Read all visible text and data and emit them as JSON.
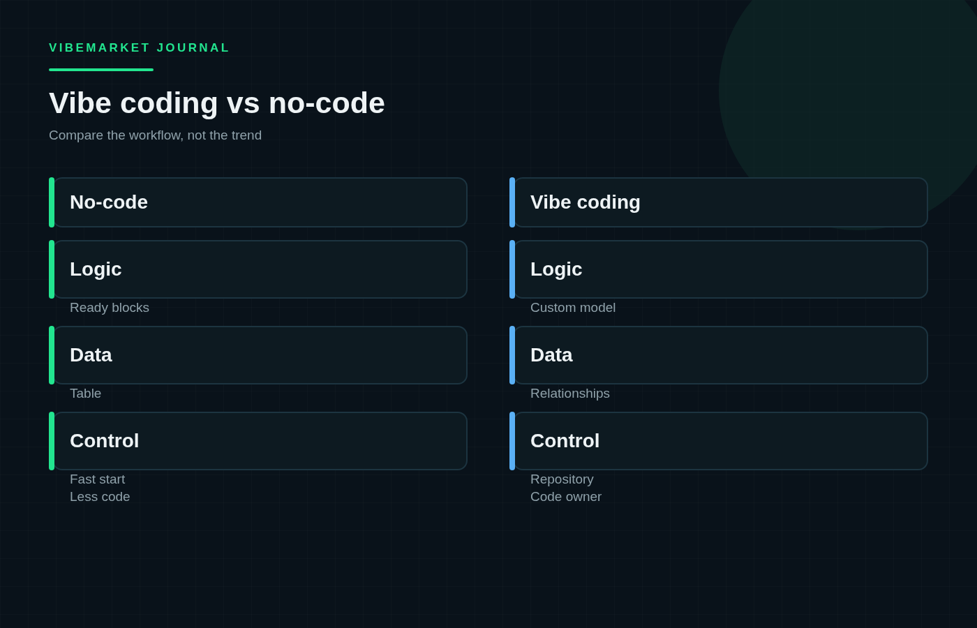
{
  "brand": "VIBEMARKET JOURNAL",
  "title": "Vibe coding vs no-code",
  "subtitle": "Compare the workflow, not the trend",
  "columns": [
    {
      "title": "No-code",
      "color": "#22e58f",
      "sections": [
        {
          "title": "Logic",
          "notes": [
            "Ready blocks"
          ]
        },
        {
          "title": "Data",
          "notes": [
            "Table"
          ]
        },
        {
          "title": "Control",
          "notes": [
            "Fast start",
            "Less code"
          ]
        }
      ]
    },
    {
      "title": "Vibe coding",
      "color": "#5ab0f5",
      "sections": [
        {
          "title": "Logic",
          "notes": [
            "Custom model"
          ]
        },
        {
          "title": "Data",
          "notes": [
            "Relationships"
          ]
        },
        {
          "title": "Control",
          "notes": [
            "Repository",
            "Code owner"
          ]
        }
      ]
    }
  ]
}
